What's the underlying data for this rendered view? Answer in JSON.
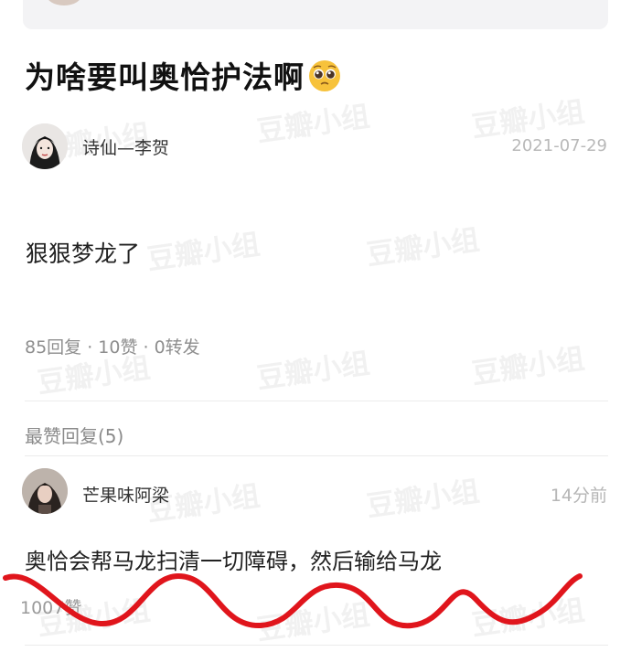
{
  "top_card": {
    "text": "·· ··· · ·· · ·"
  },
  "post": {
    "title": "为啥要叫奥恰护法啊",
    "title_emoji": "pleading-face",
    "author": "诗仙—李贺",
    "date": "2021-07-29",
    "body": "狠狠梦龙了",
    "stats": "85回复 · 10赞 · 0转发"
  },
  "replies_section": {
    "heading": "最赞回复(5)"
  },
  "reply": {
    "author": "芒果味阿梁",
    "time": "14分前",
    "text": "奥恰会帮马龙扫清一切障碍，然后输给马龙",
    "likes": "1007赞"
  },
  "watermark": "豆瓣小组",
  "annotation_color": "#e0151c"
}
